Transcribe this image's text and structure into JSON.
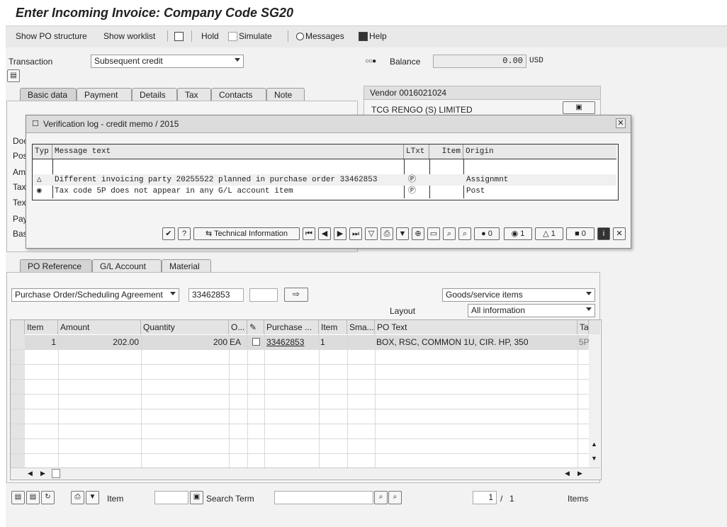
{
  "window": {
    "title": "Enter Incoming Invoice: Company Code SG20"
  },
  "toolbar": {
    "items": [
      "Show PO structure",
      "Show worklist",
      "Hold",
      "Simulate",
      "Messages",
      "Help"
    ]
  },
  "header": {
    "transaction_label": "Transaction",
    "transaction_value": "Subsequent credit",
    "balance_label": "Balance",
    "balance_value": "0.00",
    "currency": "USD"
  },
  "tabs_top": [
    "Basic data",
    "Payment",
    "Details",
    "Tax",
    "Contacts",
    "Note"
  ],
  "left_labels_partial": [
    "Doc",
    "Pos",
    "Am",
    "Tax",
    "Tex",
    "Pay",
    "Bas"
  ],
  "vendor": {
    "title": "Vendor 0016021024",
    "name": "TCG RENGO (S) LIMITED"
  },
  "dialog": {
    "title": "Verification log - credit memo  / 2015",
    "columns": [
      "Typ",
      "Message text",
      "LTxt",
      "Item",
      "Origin"
    ],
    "rows": [
      {
        "type": "warning",
        "text": "Different invoicing party 20255522 planned in purchase order 33462853",
        "item": "",
        "origin": "Assignmnt"
      },
      {
        "type": "error",
        "text": "Tax code 5P does not appear in any G/L account item",
        "item": "",
        "origin": "Post"
      }
    ],
    "technical_info_label": "Technical Information",
    "counts": {
      "stop": "0",
      "error": "1",
      "warning": "1",
      "info": "0"
    }
  },
  "tabs_bottom": [
    "PO Reference",
    "G/L Account",
    "Material"
  ],
  "po_reference": {
    "ref_type": "Purchase Order/Scheduling Agreement",
    "po_number": "33462853",
    "item_type": "Goods/service items",
    "layout_label": "Layout",
    "layout_value": "All information"
  },
  "grid": {
    "columns": [
      "Item",
      "Amount",
      "Quantity",
      "O...",
      "",
      "Purchase ...",
      "Item",
      "Sma...",
      "PO Text",
      "Ta"
    ],
    "rows": [
      {
        "item": "1",
        "amount": "202.00",
        "quantity": "200",
        "unit": "EA",
        "po": "33462853",
        "po_item": "1",
        "po_text": "BOX, RSC, COMMON 1U, CIR. HP, 350",
        "tax": "5P"
      }
    ]
  },
  "footer": {
    "item_label": "Item",
    "search_label": "Search Term",
    "page_current": "1",
    "page_sep": "/",
    "page_total": "1",
    "items_label": "Items"
  }
}
